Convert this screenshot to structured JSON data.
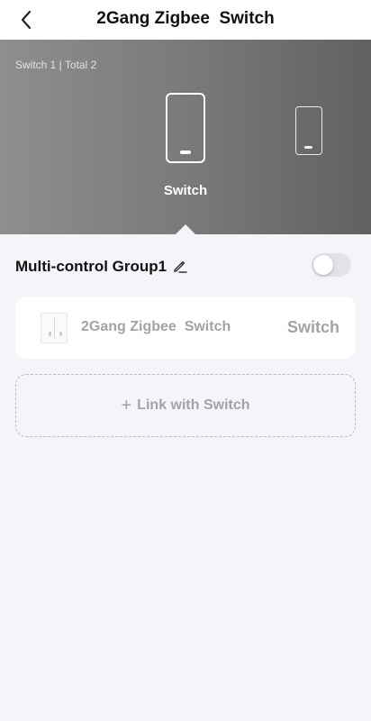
{
  "header": {
    "title": "2Gang Zigbee  Switch",
    "back_icon": "chevron-left-icon"
  },
  "banner": {
    "counter": "Switch 1 | Total 2",
    "selected_device_label": "Switch",
    "gradient_colors": [
      "#8e8e8e",
      "#616161"
    ]
  },
  "group": {
    "name": "Multi-control Group1",
    "edit_icon": "pencil-icon",
    "enabled": false
  },
  "member": {
    "device_name": "2Gang Zigbee  Switch",
    "channel": "Switch"
  },
  "link_button": {
    "label": "Link with Switch",
    "icon": "plus-icon"
  },
  "colors": {
    "background": "#f3f5f9",
    "card": "#ffffff",
    "muted_text": "#a3a3a3"
  }
}
